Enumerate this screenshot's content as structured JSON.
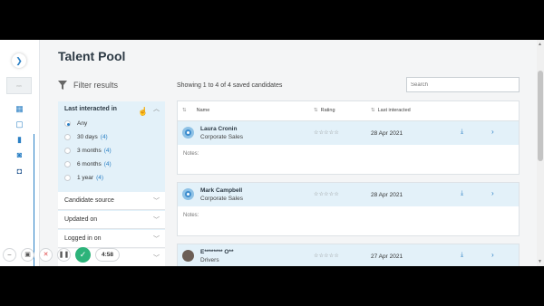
{
  "page": {
    "title": "Talent Pool"
  },
  "filters": {
    "heading": "Filter results",
    "open_group": {
      "title": "Last interacted in",
      "options": [
        {
          "label": "Any",
          "count": "",
          "selected": true
        },
        {
          "label": "30 days",
          "count": "(4)",
          "selected": false
        },
        {
          "label": "3 months",
          "count": "(4)",
          "selected": false
        },
        {
          "label": "6 months",
          "count": "(4)",
          "selected": false
        },
        {
          "label": "1 year",
          "count": "(4)",
          "selected": false
        }
      ]
    },
    "collapsed_groups": [
      {
        "label": "Candidate source"
      },
      {
        "label": "Updated on"
      },
      {
        "label": "Logged in on"
      }
    ]
  },
  "results": {
    "summary": "Showing 1 to 4 of 4 saved candidates",
    "search_placeholder": "Search",
    "columns": {
      "name": "Name",
      "rating": "Rating",
      "last_interacted": "Last interacted"
    },
    "notes_label": "Notes:",
    "candidates": [
      {
        "name": "Laura Cronin",
        "role": "Corporate Sales",
        "date": "28 Apr 2021",
        "stars": "☆☆☆☆☆"
      },
      {
        "name": "Mark Campbell",
        "role": "Corporate Sales",
        "date": "28 Apr 2021",
        "stars": "☆☆☆☆☆"
      },
      {
        "name": "E******** O**",
        "role": "Drivers",
        "date": "27 Apr 2021",
        "stars": "☆☆☆☆☆"
      }
    ]
  },
  "recorder": {
    "time": "4:58"
  },
  "colors": {
    "accent": "#2a7fc4",
    "highlight": "#e3f1f9",
    "confirm": "#2db37a"
  }
}
